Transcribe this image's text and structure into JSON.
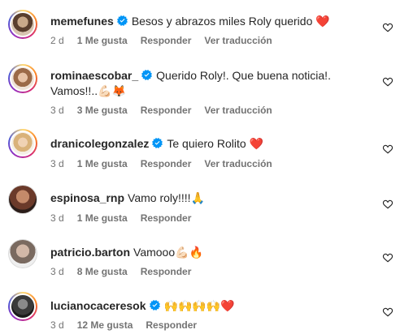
{
  "comments": [
    {
      "username": "memefunes",
      "verified": true,
      "text": "Besos y abrazos miles Roly querido",
      "emoji": "❤️",
      "age": "2 d",
      "likes": "1 Me gusta",
      "reply": "Responder",
      "translate": "Ver traducción"
    },
    {
      "username": "rominaescobar_",
      "verified": true,
      "text": "Querido Roly!. Que buena noticia!. Vamos!!..",
      "emoji": "💪🏻🦊",
      "age": "3 d",
      "likes": "3 Me gusta",
      "reply": "Responder",
      "translate": "Ver traducción"
    },
    {
      "username": "dranicolegonzalez",
      "verified": true,
      "text": "Te quiero Rolito",
      "emoji": "❤️",
      "age": "3 d",
      "likes": "1 Me gusta",
      "reply": "Responder",
      "translate": "Ver traducción"
    },
    {
      "username": "espinosa_rnp",
      "verified": false,
      "text": "Vamo roly!!!!",
      "emoji": "🙏",
      "age": "3 d",
      "likes": "1 Me gusta",
      "reply": "Responder"
    },
    {
      "username": "patricio.barton",
      "verified": false,
      "text": "Vamooo",
      "emoji": "💪🏻🔥",
      "age": "3 d",
      "likes": "8 Me gusta",
      "reply": "Responder"
    },
    {
      "username": "lucianocaceresok",
      "verified": true,
      "text": "",
      "emoji": "🙌🙌🙌🙌❤️",
      "age": "3 d",
      "likes": "12 Me gusta",
      "reply": "Responder"
    }
  ],
  "colors": {
    "text": "#262626",
    "secondary": "#737373",
    "verified": "#0095f6",
    "heart": "#e0245e"
  },
  "icons": {
    "verified": "verified-badge-icon",
    "like": "heart-outline-icon"
  }
}
